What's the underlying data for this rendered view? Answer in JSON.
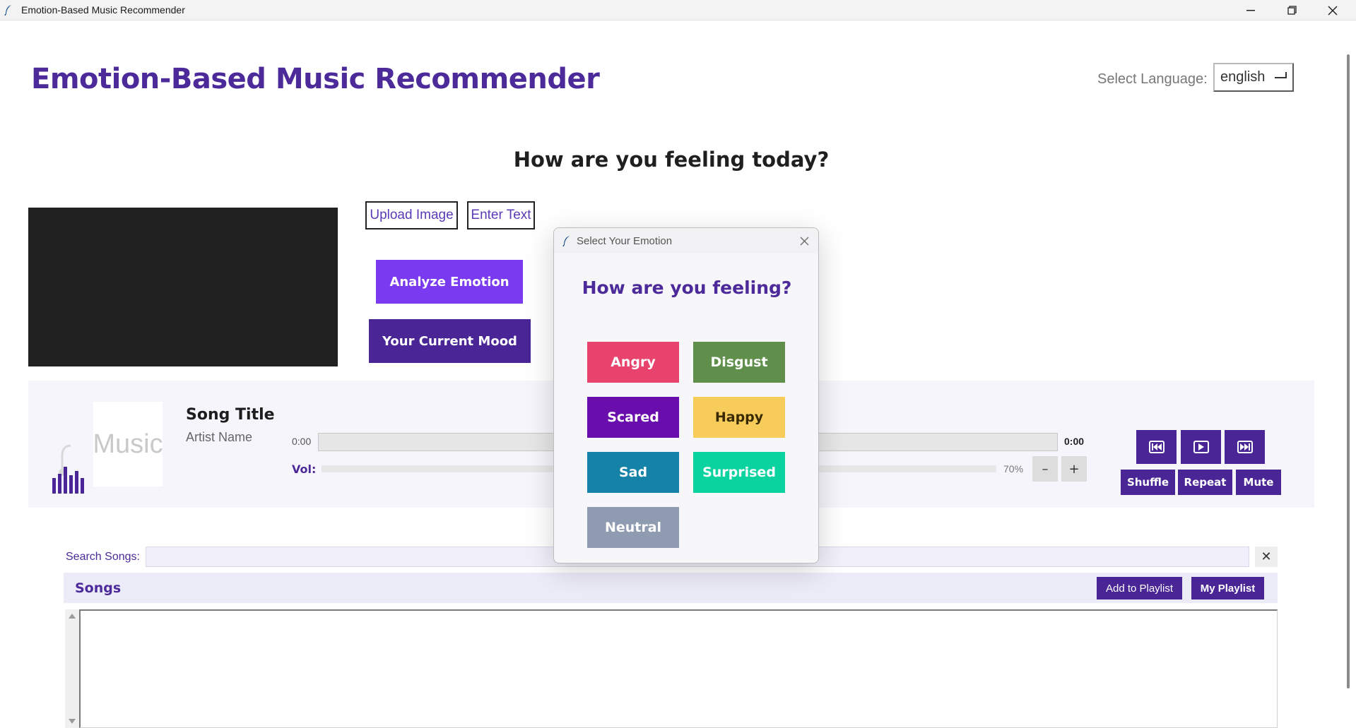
{
  "window": {
    "title": "Emotion-Based Music Recommender",
    "minimize": "—",
    "restore": "❐",
    "close": "✕"
  },
  "header": {
    "app_title": "Emotion-Based Music Recommender",
    "language_label": "Select Language:",
    "language_value": "english"
  },
  "main": {
    "question": "How are you feeling today?",
    "upload_image": "Upload Image",
    "enter_text": "Enter Text",
    "analyze_emotion": "Analyze Emotion",
    "current_mood": "Your Current Mood"
  },
  "player": {
    "album_placeholder": "Music",
    "song_title": "Song Title",
    "artist_name": "Artist Name",
    "time_elapsed": "0:00",
    "time_total": "0:00",
    "progress": 0,
    "volume_label": "Vol:",
    "volume_percent": "70%",
    "volume_level": 0.7,
    "volume_down": "–",
    "volume_up": "+",
    "shuffle": "Shuffle",
    "repeat": "Repeat",
    "mute": "Mute"
  },
  "library": {
    "search_label": "Search Songs:",
    "search_value": "",
    "clear": "✕",
    "songs_title": "Songs",
    "add_to_playlist": "Add to Playlist",
    "my_playlist": "My Playlist",
    "songs": []
  },
  "modal": {
    "title": "Select Your Emotion",
    "close": "✕",
    "heading": "How are you feeling?",
    "emotions": [
      {
        "label": "Angry",
        "color": "#e8436d",
        "text_color": "#ffffff"
      },
      {
        "label": "Disgust",
        "color": "#5f8f4a",
        "text_color": "#ffffff"
      },
      {
        "label": "Scared",
        "color": "#6a0dad",
        "text_color": "#ffffff"
      },
      {
        "label": "Happy",
        "color": "#f8cc5b",
        "text_color": "#3a2a00"
      },
      {
        "label": "Sad",
        "color": "#1583a7",
        "text_color": "#ffffff"
      },
      {
        "label": "Surprised",
        "color": "#0ad3a0",
        "text_color": "#ffffff"
      },
      {
        "label": "Neutral",
        "color": "#8f9bb0",
        "text_color": "#ffffff"
      }
    ]
  },
  "colors": {
    "accent": "#4a2596",
    "accent_light": "#7a3af0",
    "heading": "#4c2a9a"
  }
}
